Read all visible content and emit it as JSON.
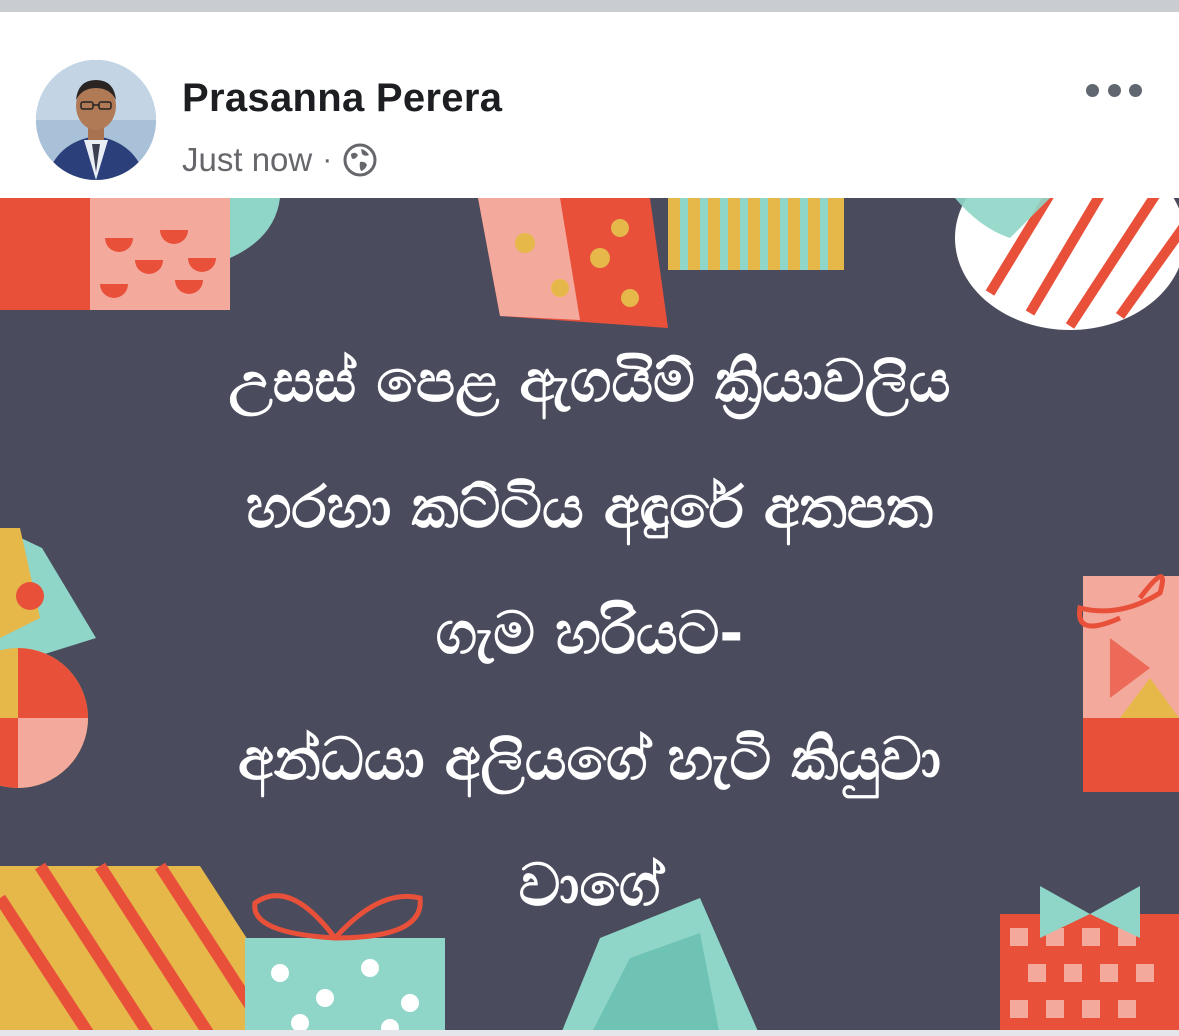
{
  "post": {
    "author": "Prasanna Perera",
    "timestamp": "Just now",
    "separator": "·",
    "privacy_icon": "globe-icon",
    "more_icon": "more-horizontal-icon"
  },
  "image": {
    "lines": [
      "උසස් පෙළ ඇගයිම් ක්‍රියාවලිය",
      "හරහා කට්ටිය අඳුරේ අතපත",
      "ගැම හරියට-",
      "අන්ධයා අලියගේ හැටි කියුවා",
      "වාගේ"
    ],
    "background_color": "#4a4c5e",
    "text_color": "#ffffff"
  },
  "colors": {
    "name_text": "#1c1e21",
    "meta_text": "#65676b",
    "coral": "#e8503a",
    "teal": "#8fd6c8",
    "pink": "#f3a99b",
    "mustard": "#e6b84a"
  }
}
